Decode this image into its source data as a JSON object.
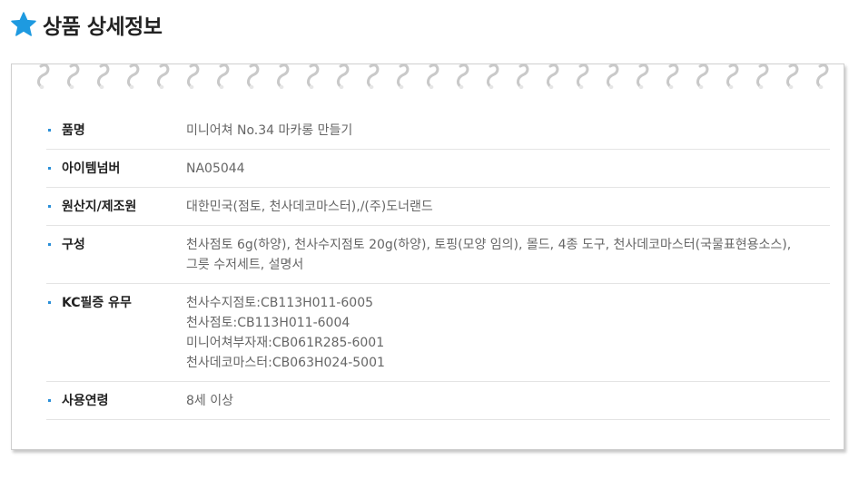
{
  "header": {
    "title": "상품 상세정보",
    "icon": "star-icon",
    "icon_color": "#1e9ae0"
  },
  "rows": [
    {
      "label": "품명",
      "lines": [
        "미니어쳐 No.34 마카롱 만들기"
      ]
    },
    {
      "label": "아이템넘버",
      "lines": [
        "NA05044"
      ]
    },
    {
      "label": "원산지/제조원",
      "lines": [
        "대한민국(점토, 천사데코마스터),/(주)도너랜드"
      ]
    },
    {
      "label": "구성",
      "lines": [
        "천사점토 6g(하양), 천사수지점토 20g(하양), 토핑(모양 임의),  몰드, 4종 도구, 천사데코마스터(국물표현용소스),",
        "그릇 수저세트, 설명서"
      ]
    },
    {
      "label": "KC필증 유무",
      "lines": [
        "천사수지점토:CB113H011-6005",
        "천사점토:CB113H011-6004",
        "미니어쳐부자재:CB061R285-6001",
        "천사데코마스터:CB063H024-5001"
      ]
    },
    {
      "label": "사용연령",
      "lines": [
        "8세 이상"
      ]
    }
  ]
}
